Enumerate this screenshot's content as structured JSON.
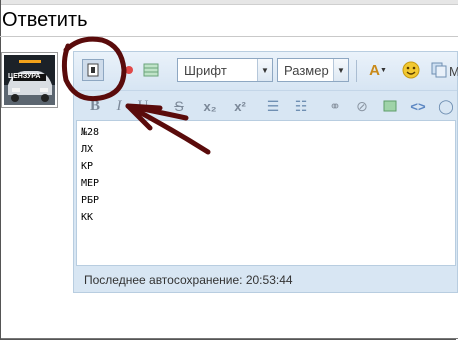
{
  "page": {
    "title": "Ответить",
    "avatar_text": "ЦЕНЗУРА"
  },
  "toolbar": {
    "font_select": "Шрифт",
    "size_select": "Размер",
    "bold": "B",
    "italic": "I",
    "underline": "U",
    "strike": "S",
    "subscript": "x₂",
    "superscript": "x²",
    "more_label": "M"
  },
  "editor": {
    "lines": [
      "№28",
      "ЛХ",
      "КР",
      "МЕР",
      "РБР",
      "КК"
    ],
    "autosave": "Последнее автосохранение: 20:53:44"
  },
  "icons": {
    "source": "source-mode-icon",
    "font_color": "font-color-icon",
    "smiley": "smiley-icon",
    "link": "link-icon",
    "unlink": "unlink-icon",
    "image": "image-icon",
    "code": "code-icon",
    "quote": "quote-icon"
  },
  "colors": {
    "toolbar_bg": "#d8e6f3",
    "annotation": "#5a0b0b"
  }
}
